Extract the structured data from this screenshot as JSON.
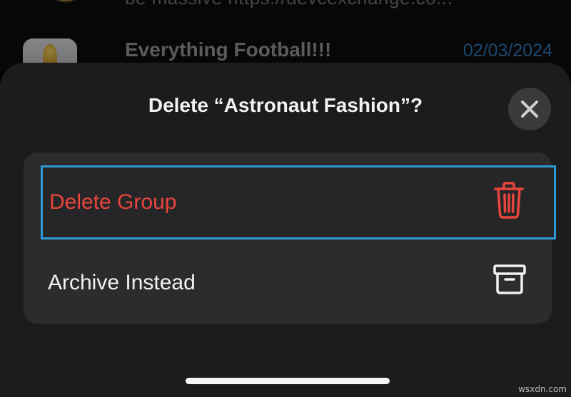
{
  "background": {
    "row1": {
      "preview": "be massive https://devcexchange.co..."
    },
    "row2": {
      "title": "Everything Football!!!",
      "date": "02/03/2024"
    }
  },
  "sheet": {
    "title": "Delete “Astronaut Fashion”?",
    "close_icon": "close-x-icon",
    "options": [
      {
        "label": "Delete Group",
        "icon": "trash-icon",
        "color": "#e8453c",
        "selected": true
      },
      {
        "label": "Archive Instead",
        "icon": "archive-box-icon",
        "color": "#f2f2f2",
        "selected": false
      }
    ]
  },
  "colors": {
    "sheet_bg": "#1c1c1e",
    "options_bg": "#2c2c2e",
    "destructive": "#e8453c",
    "focus_outline": "#2b9ad8",
    "date_link": "#2f6fa8"
  },
  "watermark": "wsxdn.com"
}
